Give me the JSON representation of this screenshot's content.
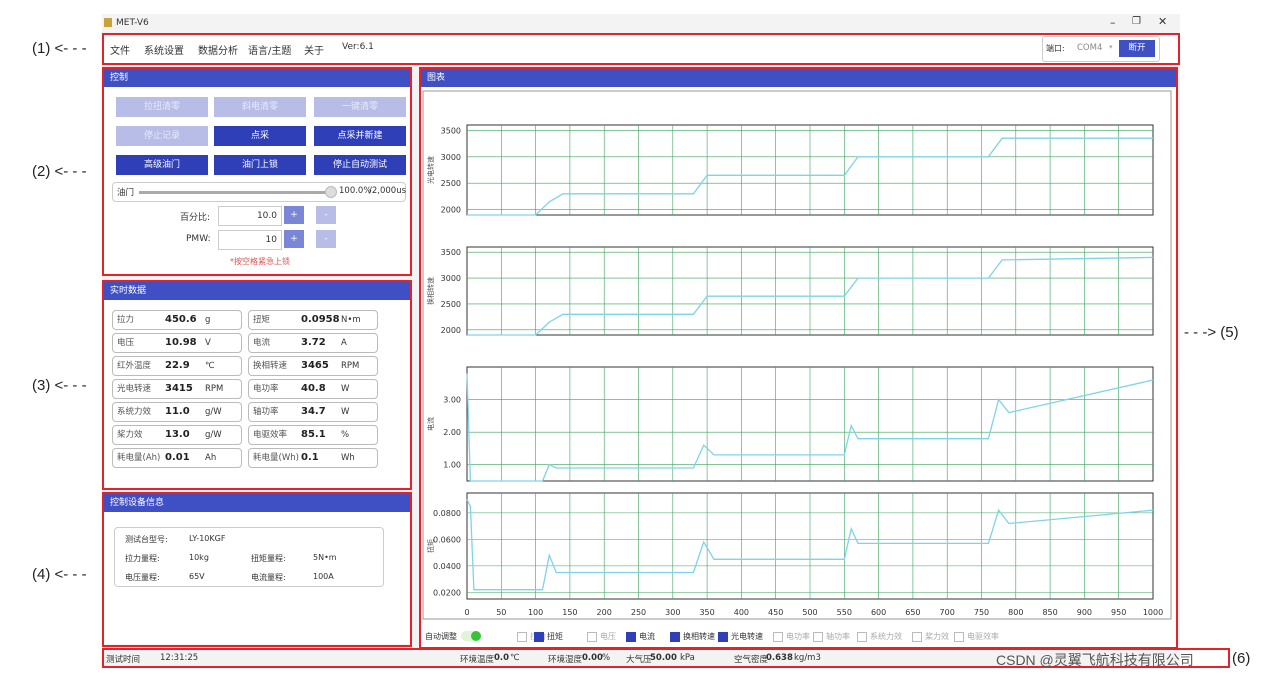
{
  "annotations": {
    "a1": "(1)",
    "a2": "(2)",
    "a3": "(3)",
    "a4": "(4)",
    "a5": "(5)",
    "a6": "(6)"
  },
  "window": {
    "title": "MET-V6"
  },
  "menu": {
    "items": [
      "文件",
      "系统设置",
      "数据分析",
      "语言/主题",
      "关于",
      "Ver:6.1"
    ],
    "port_label": "端口:",
    "port_value": "COM4",
    "disconnect": "断开"
  },
  "control": {
    "title": "控制",
    "buttons": [
      "拉扭清零",
      "斜电清零",
      "一键清零",
      "停止记录",
      "点采",
      "点采并新建",
      "高级油门",
      "油门上锁",
      "停止自动测试"
    ],
    "throttle_label": "油门",
    "throttle_value": "100.0%",
    "throttle_max": "/2,000us",
    "throttle_level": 1.0,
    "percent_label": "百分比:",
    "percent_value": "10.0",
    "pmw_label": "PMW:",
    "pmw_value": "10",
    "plus": "+",
    "minus": "-",
    "hint": "*按空格紧急上锁"
  },
  "realtime": {
    "title": "实时数据",
    "items": [
      {
        "label": "拉力",
        "value": "450.6",
        "unit": "g"
      },
      {
        "label": "扭矩",
        "value": "0.0958",
        "unit": "N•m"
      },
      {
        "label": "电压",
        "value": "10.98",
        "unit": "V"
      },
      {
        "label": "电流",
        "value": "3.72",
        "unit": "A"
      },
      {
        "label": "红外温度",
        "value": "22.9",
        "unit": "℃"
      },
      {
        "label": "换相转速",
        "value": "3465",
        "unit": "RPM"
      },
      {
        "label": "光电转速",
        "value": "3415",
        "unit": "RPM"
      },
      {
        "label": "电功率",
        "value": "40.8",
        "unit": "W"
      },
      {
        "label": "系统力效",
        "value": "11.0",
        "unit": "g/W"
      },
      {
        "label": "轴功率",
        "value": "34.7",
        "unit": "W"
      },
      {
        "label": "桨力效",
        "value": "13.0",
        "unit": "g/W"
      },
      {
        "label": "电驱效率",
        "value": "85.1",
        "unit": "%"
      },
      {
        "label": "耗电量(Ah)",
        "value": "0.01",
        "unit": "Ah"
      },
      {
        "label": "耗电量(Wh)",
        "value": "0.1",
        "unit": "Wh"
      }
    ]
  },
  "device": {
    "title": "控制设备信息",
    "model_label": "测试台型号:",
    "model_value": "LY-10KGF",
    "rows": [
      {
        "l1": "拉力量程:",
        "v1": "10kg",
        "l2": "扭矩量程:",
        "v2": "5N•m"
      },
      {
        "l1": "电压量程:",
        "v1": "65V",
        "l2": "电流量程:",
        "v2": "100A"
      }
    ]
  },
  "chart_panel": {
    "title": "图表",
    "auto_label": "自动调整",
    "checks": [
      {
        "label": "拉力",
        "on": false
      },
      {
        "label": "扭矩",
        "on": true
      },
      {
        "label": "电压",
        "on": false
      },
      {
        "label": "电流",
        "on": true
      },
      {
        "label": "换相转速",
        "on": true
      },
      {
        "label": "光电转速",
        "on": true
      },
      {
        "label": "电功率",
        "on": false
      },
      {
        "label": "轴功率",
        "on": false
      },
      {
        "label": "系统力效",
        "on": false
      },
      {
        "label": "桨力效",
        "on": false
      },
      {
        "label": "电驱效率",
        "on": false
      }
    ]
  },
  "chart_data": [
    {
      "type": "line",
      "ylabel": "光电转速",
      "yticks": [
        "3500",
        "3000",
        "2500",
        "2000"
      ],
      "ylim": [
        1900,
        3600
      ],
      "x": [
        0,
        100,
        120,
        140,
        330,
        350,
        550,
        570,
        760,
        780,
        1000
      ],
      "values": [
        1900,
        1900,
        2150,
        2300,
        2300,
        2650,
        2650,
        3000,
        3000,
        3350,
        3350
      ]
    },
    {
      "type": "line",
      "ylabel": "换相转速",
      "yticks": [
        "3500",
        "3000",
        "2500",
        "2000"
      ],
      "ylim": [
        1900,
        3600
      ],
      "x": [
        0,
        100,
        120,
        140,
        330,
        350,
        550,
        570,
        760,
        780,
        1000
      ],
      "values": [
        1900,
        1900,
        2150,
        2300,
        2300,
        2650,
        2650,
        3000,
        3000,
        3350,
        3400
      ]
    },
    {
      "type": "line",
      "ylabel": "电流",
      "yticks": [
        "3.00",
        "2.00",
        "1.00"
      ],
      "ylim": [
        0.5,
        4.0
      ],
      "x": [
        0,
        5,
        110,
        120,
        130,
        330,
        345,
        360,
        550,
        560,
        570,
        760,
        775,
        790,
        1000
      ],
      "values": [
        3.8,
        0.5,
        0.5,
        1.0,
        0.9,
        0.9,
        1.6,
        1.3,
        1.3,
        2.2,
        1.8,
        1.8,
        3.0,
        2.6,
        3.6
      ]
    },
    {
      "type": "line",
      "ylabel": "扭矩",
      "yticks": [
        "0.0800",
        "0.0600",
        "0.0400",
        "0.0200"
      ],
      "ylim": [
        0.015,
        0.095
      ],
      "x": [
        0,
        5,
        10,
        110,
        120,
        130,
        330,
        345,
        360,
        550,
        560,
        570,
        760,
        775,
        790,
        1000
      ],
      "values": [
        0.09,
        0.085,
        0.022,
        0.022,
        0.048,
        0.035,
        0.035,
        0.058,
        0.045,
        0.045,
        0.068,
        0.057,
        0.057,
        0.082,
        0.072,
        0.082
      ],
      "xticks": [
        "0",
        "50",
        "100",
        "150",
        "200",
        "250",
        "300",
        "350",
        "400",
        "450",
        "500",
        "550",
        "600",
        "650",
        "700",
        "750",
        "800",
        "850",
        "900",
        "950",
        "1000"
      ],
      "xlim": [
        0,
        1000
      ]
    }
  ],
  "status": {
    "elapsed_label": "测试时间",
    "elapsed": "12:31:25",
    "env_temp_label": "环境温度",
    "env_temp": "0.0",
    "env_temp_unit": "℃",
    "humidity_label": "环境湿度",
    "humidity": "0.00",
    "humidity_unit": "%",
    "pressure_label": "大气压",
    "pressure": "50.00",
    "pressure_unit": "kPa",
    "density_label": "空气密度",
    "density": "0.638",
    "density_unit": "kg/m3"
  },
  "watermark": "CSDN @灵翼飞航科技有限公司",
  "colors": {
    "accent": "#3f4fc4",
    "line": "#7fd3e8",
    "grid": "#3aa35a",
    "highlight": "#e4222b"
  }
}
